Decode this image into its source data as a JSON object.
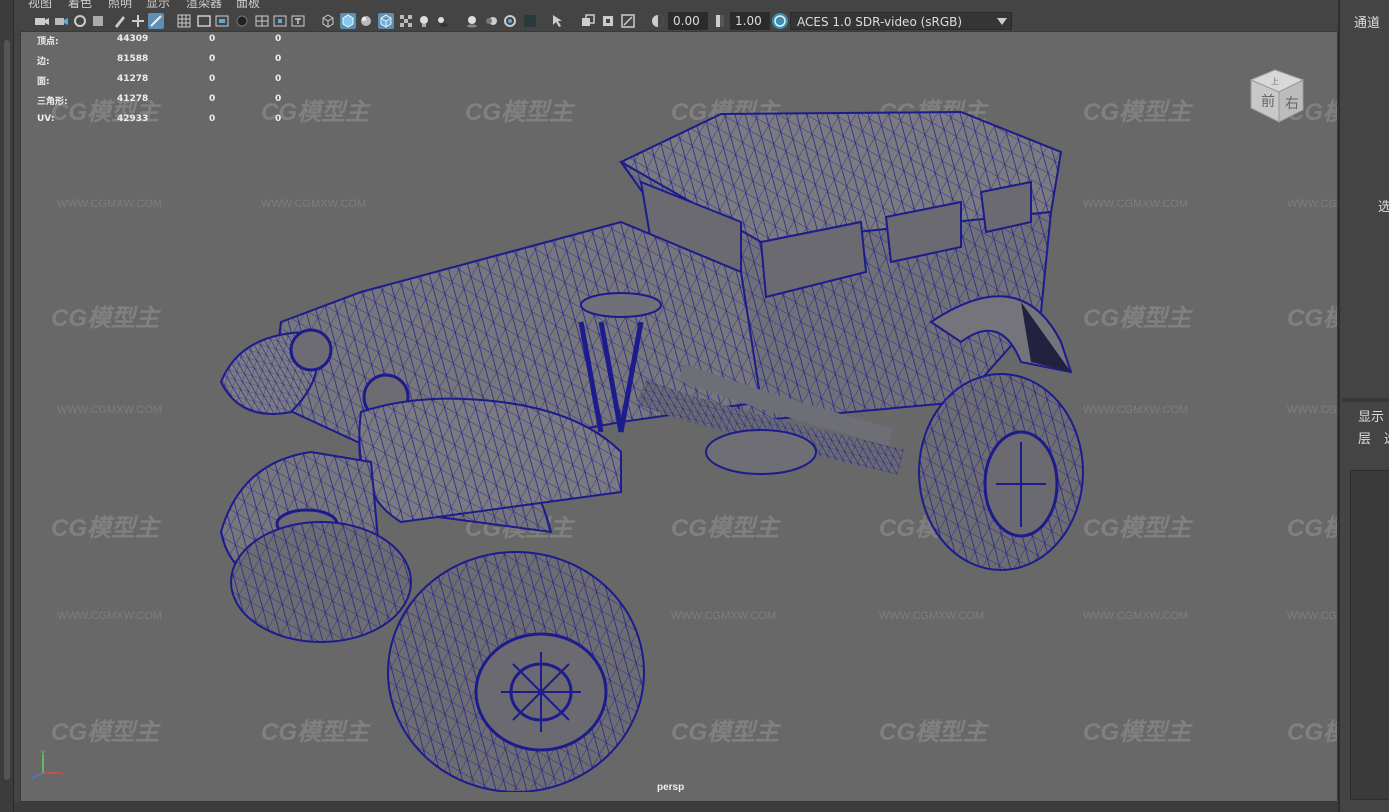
{
  "menu": [
    "视图",
    "着色",
    "照明",
    "显示",
    "渲染器",
    "面板"
  ],
  "toolbar": {
    "exposure_value": "0.00",
    "gamma_value": "1.00",
    "color_space": "ACES 1.0 SDR-video (sRGB)"
  },
  "hud": {
    "rows": [
      {
        "label": "顶点:",
        "count": "44309",
        "a": "0",
        "b": "0"
      },
      {
        "label": "边:",
        "count": "81588",
        "a": "0",
        "b": "0"
      },
      {
        "label": "面:",
        "count": "41278",
        "a": "0",
        "b": "0"
      },
      {
        "label": "三角形:",
        "count": "41278",
        "a": "0",
        "b": "0"
      },
      {
        "label": "UV:",
        "count": "42933",
        "a": "0",
        "b": "0"
      }
    ]
  },
  "viewport": {
    "camera_label": "persp",
    "viewcube": {
      "front": "前",
      "right": "右",
      "top": "上"
    },
    "axis": {
      "x": "x",
      "y": "y",
      "z": "z"
    }
  },
  "watermark": {
    "brand": "CG模型主",
    "url": "WWW.CGMXW.COM"
  },
  "right_panel": {
    "channels_tab": "通道",
    "select_tab": "选",
    "display_tab": "显示",
    "layer_label": "层",
    "options_label": "选"
  },
  "colors": {
    "wire": "#1c1c8c",
    "viewport_bg": "#686868",
    "selected_icon": "#5f8fb0"
  }
}
